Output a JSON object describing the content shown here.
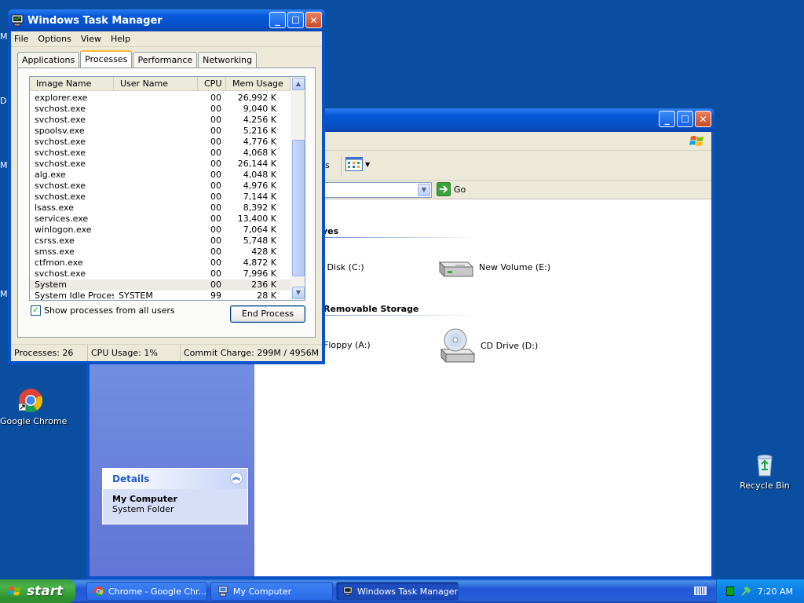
{
  "desktop": {
    "edge_letters": [
      "M",
      "D",
      "M",
      "M"
    ],
    "icons": {
      "chrome": {
        "label": "Google Chrome"
      },
      "recycle": {
        "label": "Recycle Bin"
      }
    }
  },
  "my_computer": {
    "title": "",
    "toolbar_fragment": "s",
    "address_go": "Go",
    "groups": {
      "hard_drives": {
        "heading_fragment": "ves"
      },
      "removable": {
        "heading_fragment": "Removable Storage"
      }
    },
    "drives": {
      "c": "l Disk (C:)",
      "e": "New Volume (E:)",
      "a": "Floppy (A:)",
      "d": "CD Drive (D:)"
    },
    "details": {
      "heading": "Details",
      "name": "My Computer",
      "type": "System Folder"
    }
  },
  "task_manager": {
    "title": "Windows Task Manager",
    "menu": [
      "File",
      "Options",
      "View",
      "Help"
    ],
    "tabs": [
      "Applications",
      "Processes",
      "Performance",
      "Networking"
    ],
    "active_tab": "Processes",
    "columns": [
      "Image Name",
      "User Name",
      "CPU",
      "Mem Usage"
    ],
    "processes": [
      {
        "name": "explorer.exe",
        "user": "",
        "cpu": "00",
        "mem": "26,992 K"
      },
      {
        "name": "svchost.exe",
        "user": "",
        "cpu": "00",
        "mem": "9,040 K"
      },
      {
        "name": "svchost.exe",
        "user": "",
        "cpu": "00",
        "mem": "4,256 K"
      },
      {
        "name": "spoolsv.exe",
        "user": "",
        "cpu": "00",
        "mem": "5,216 K"
      },
      {
        "name": "svchost.exe",
        "user": "",
        "cpu": "00",
        "mem": "4,776 K"
      },
      {
        "name": "svchost.exe",
        "user": "",
        "cpu": "00",
        "mem": "4,068 K"
      },
      {
        "name": "svchost.exe",
        "user": "",
        "cpu": "00",
        "mem": "26,144 K"
      },
      {
        "name": "alg.exe",
        "user": "",
        "cpu": "00",
        "mem": "4,048 K"
      },
      {
        "name": "svchost.exe",
        "user": "",
        "cpu": "00",
        "mem": "4,976 K"
      },
      {
        "name": "svchost.exe",
        "user": "",
        "cpu": "00",
        "mem": "7,144 K"
      },
      {
        "name": "lsass.exe",
        "user": "",
        "cpu": "00",
        "mem": "8,392 K"
      },
      {
        "name": "services.exe",
        "user": "",
        "cpu": "00",
        "mem": "13,400 K"
      },
      {
        "name": "winlogon.exe",
        "user": "",
        "cpu": "00",
        "mem": "7,064 K"
      },
      {
        "name": "csrss.exe",
        "user": "",
        "cpu": "00",
        "mem": "5,748 K"
      },
      {
        "name": "smss.exe",
        "user": "",
        "cpu": "00",
        "mem": "428 K"
      },
      {
        "name": "ctfmon.exe",
        "user": "",
        "cpu": "00",
        "mem": "4,872 K"
      },
      {
        "name": "svchost.exe",
        "user": "",
        "cpu": "00",
        "mem": "7,996 K"
      },
      {
        "name": "System",
        "user": "",
        "cpu": "00",
        "mem": "236 K"
      },
      {
        "name": "System Idle Process",
        "user": "SYSTEM",
        "cpu": "99",
        "mem": "28 K"
      }
    ],
    "show_all_label": "Show processes from all users",
    "show_all_checked": true,
    "end_process_label": "End Process",
    "status": {
      "processes": "Processes: 26",
      "cpu": "CPU Usage: 1%",
      "commit": "Commit Charge: 299M / 4956M"
    }
  },
  "taskbar": {
    "start_label": "start",
    "buttons": [
      {
        "label": "Chrome - Google Chr..."
      },
      {
        "label": "My Computer"
      },
      {
        "label": "Windows Task Manager"
      }
    ],
    "clock": "7:20 AM"
  }
}
